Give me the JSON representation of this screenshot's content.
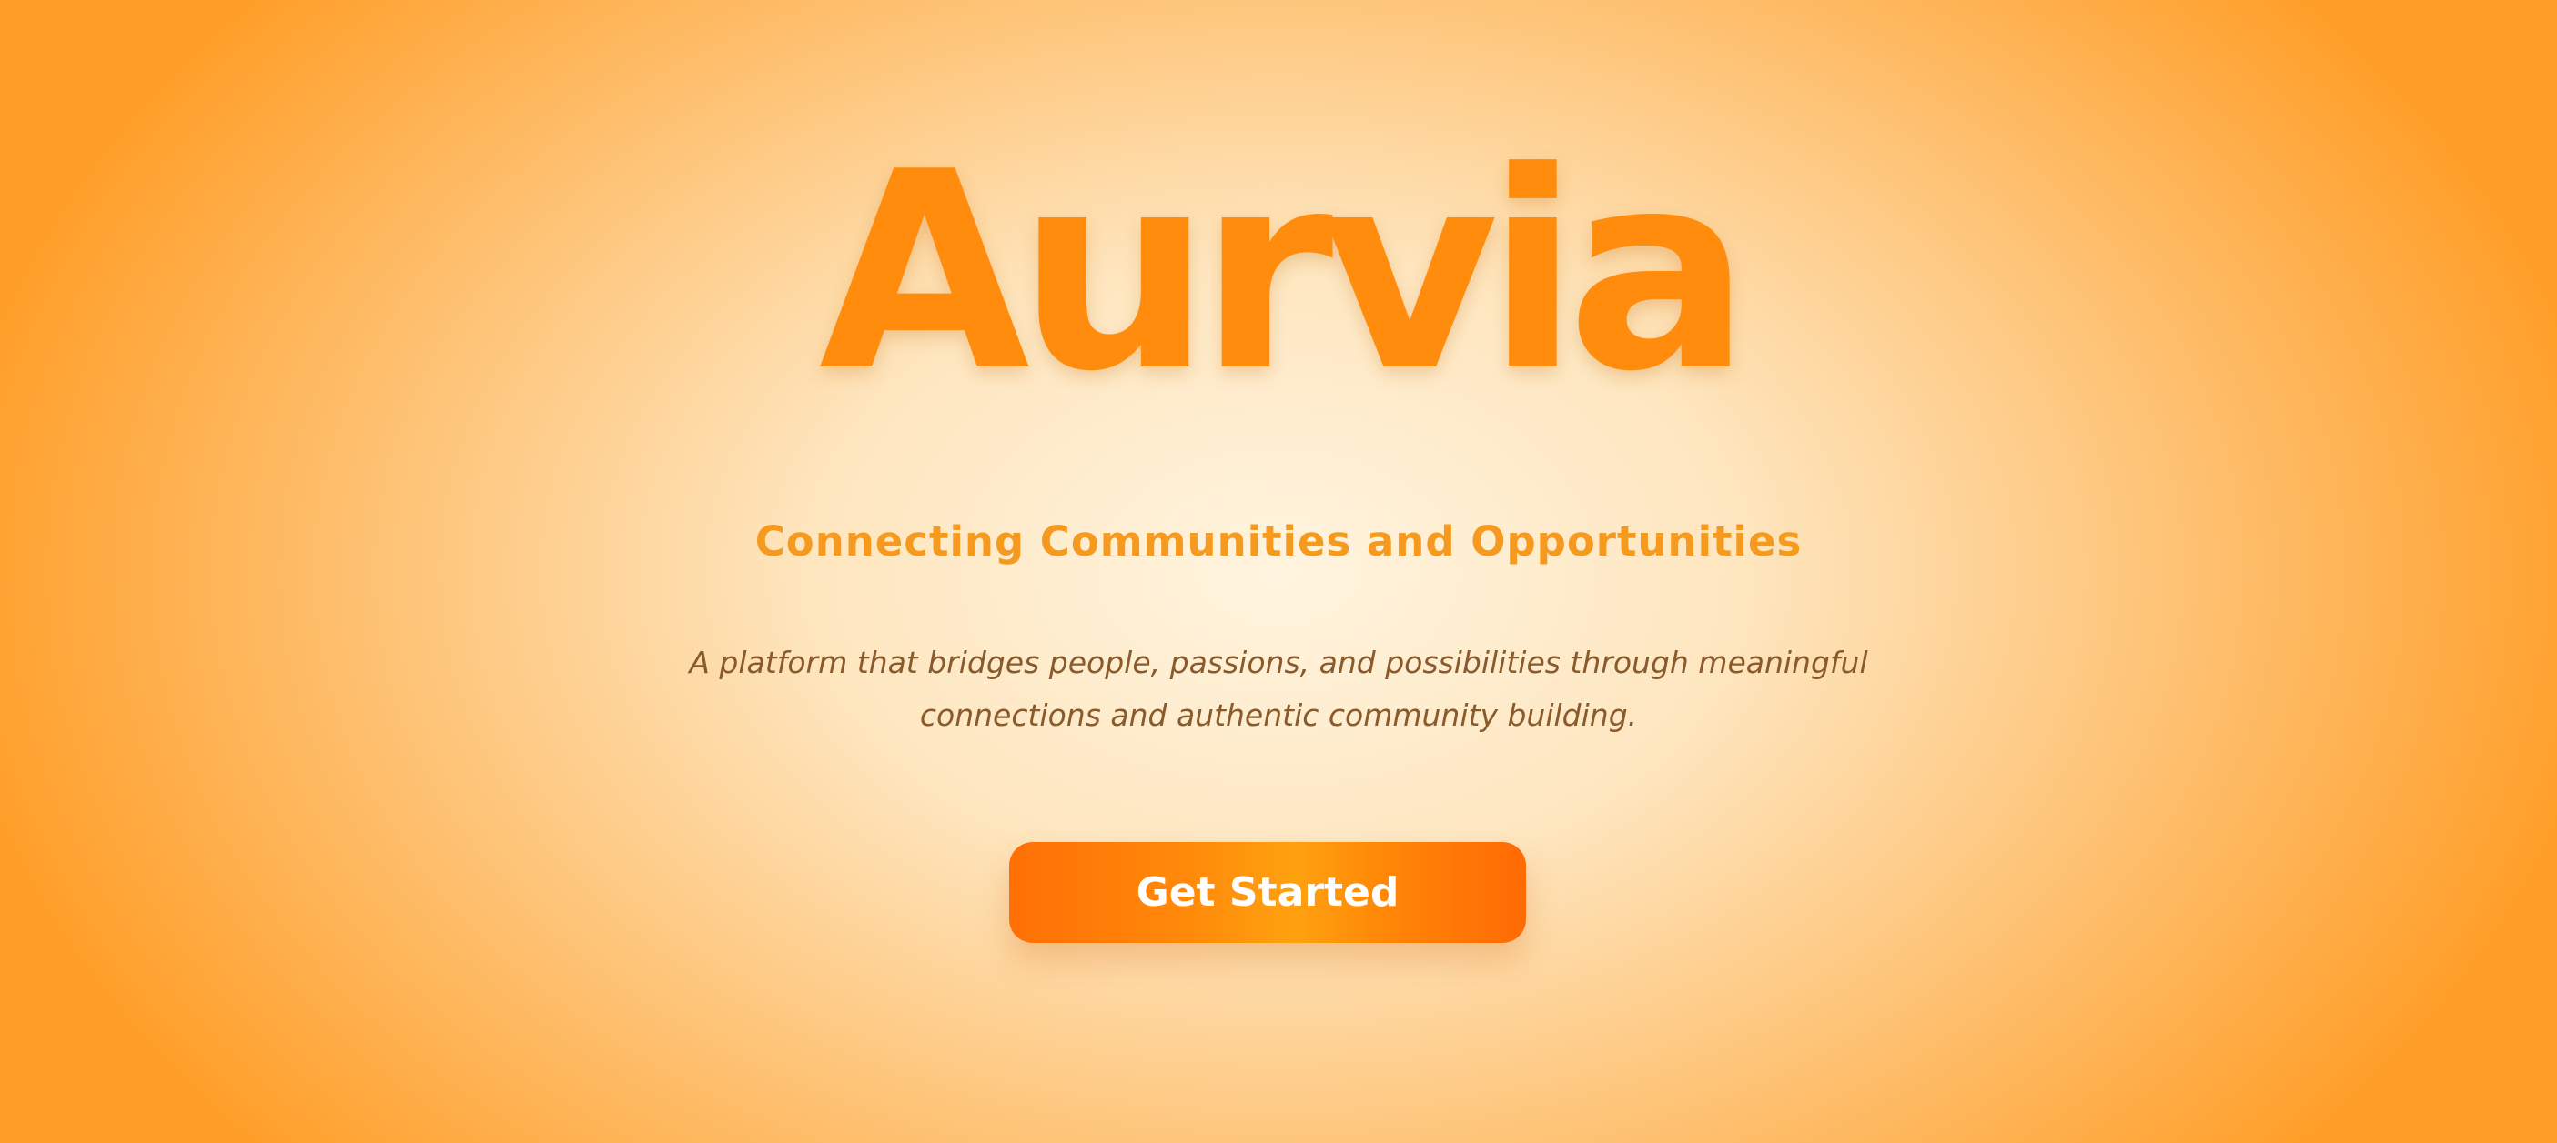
{
  "hero": {
    "title": "Aurvia",
    "tagline": "Connecting Communities and Opportunities",
    "description": "A platform that bridges people, passions, and possibilities through meaningful connections and authentic community building.",
    "cta_label": "Get Started"
  },
  "colors": {
    "title": "#ff8c0d",
    "tagline": "#f59a1f",
    "description": "#8a5a2b",
    "button_start": "#ff6f06",
    "button_mid": "#ffa10f",
    "button_text": "#ffffff",
    "background_center": "#fff4df",
    "background_edge": "#ff9f2a"
  }
}
